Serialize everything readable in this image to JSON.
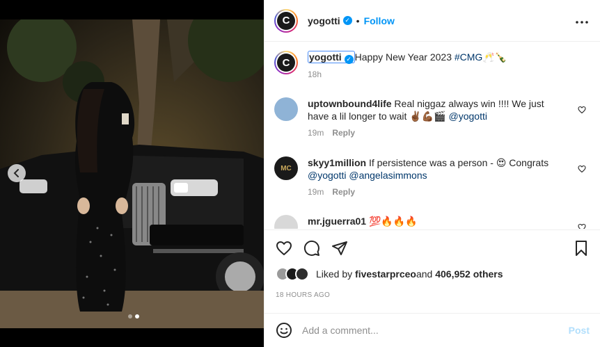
{
  "media": {
    "carousel_count": 2,
    "carousel_active": 2,
    "prev_icon": "chevron-left-icon",
    "photo_description_icon": "photo"
  },
  "header": {
    "username": "yogotti",
    "verified": true,
    "bullet": "•",
    "follow_label": "Follow",
    "more_icon": "more-horizontal-icon",
    "avatar_letter": "C"
  },
  "caption": {
    "username": "yogotti",
    "text": "Happy New Year 2023 ",
    "hashtag": "#CMG",
    "emoji": "🥂🍾",
    "time": "18h"
  },
  "comments": [
    {
      "username": "uptownbound4life",
      "text": "Real niggaz always win !!!! We just have a lil longer to wait ✌🏾💪🏾🎬 ",
      "mentions": [
        "@yogotti"
      ],
      "time": "19m",
      "reply_label": "Reply",
      "avatar_color": "#8fb3d6"
    },
    {
      "username": "skyy1million",
      "text": "If persistence was a person - 😍 Congrats ",
      "mentions": [
        "@yogotti",
        "@angelasimmons"
      ],
      "time": "19m",
      "reply_label": "Reply",
      "avatar_color": "#1a1a1a"
    },
    {
      "username": "mr.jguerra01",
      "text": "💯🔥🔥🔥",
      "time": "",
      "reply_label": "",
      "avatar_color": "#d8d8d8"
    }
  ],
  "actions": {
    "like_icon": "heart-icon",
    "comment_icon": "comment-icon",
    "share_icon": "send-icon",
    "save_icon": "bookmark-icon"
  },
  "likes": {
    "prefix": "Liked by ",
    "user": "fivestarprceo",
    "middle": " and ",
    "count": "406,952 others"
  },
  "timestamp": "18 HOURS AGO",
  "add_comment": {
    "placeholder": "Add a comment...",
    "post_label": "Post",
    "emoji_icon": "smiley-icon"
  },
  "colors": {
    "accent": "#0095f6",
    "post_disabled": "#b2dffc",
    "mention": "#00376b"
  }
}
